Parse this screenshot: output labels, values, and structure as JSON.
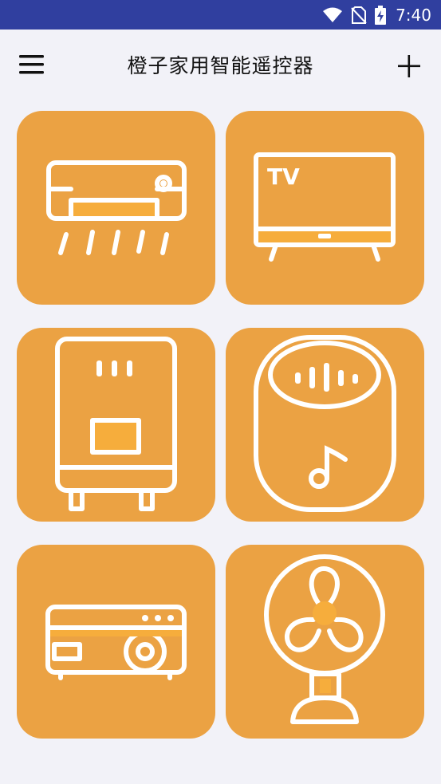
{
  "status_bar": {
    "time": "7:40",
    "icons": [
      "wifi-icon",
      "no-sim-icon",
      "battery-charging-icon"
    ]
  },
  "app_bar": {
    "title": "橙子家用智能遥控器",
    "menu_icon": "hamburger-menu-icon",
    "add_icon": "plus-icon"
  },
  "colors": {
    "status_bar": "#303f9f",
    "background": "#f2f2f8",
    "tile": "#eba243",
    "accent": "#f6ad3c",
    "icon_line": "#ffffff"
  },
  "devices": [
    {
      "icon": "air-conditioner-icon"
    },
    {
      "icon": "tv-icon",
      "label": "TV"
    },
    {
      "icon": "water-heater-icon"
    },
    {
      "icon": "smart-speaker-icon"
    },
    {
      "icon": "projector-icon"
    },
    {
      "icon": "fan-icon"
    }
  ]
}
